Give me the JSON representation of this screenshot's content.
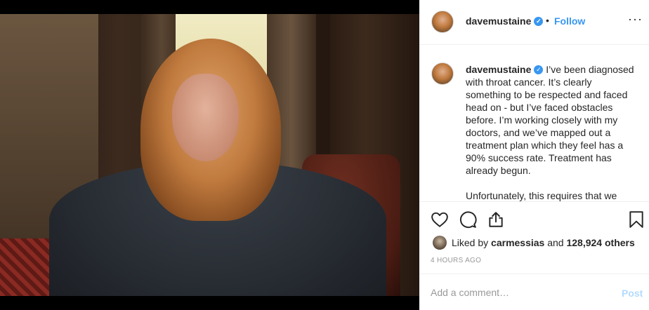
{
  "post": {
    "username": "davemustaine",
    "follow_label": "Follow",
    "dot": "•",
    "more": "···",
    "caption": "I’ve been diagnosed with throat cancer. It’s clearly something to be respected and faced head on - but I’ve faced obstacles before. I’m working closely with my doctors, and we’ve mapped out a treatment plan which they feel has a 90% success rate. Treatment has already begun.\n\nUnfortunately, this requires that we",
    "verified_glyph": "✓"
  },
  "likes": {
    "prefix": "Liked by ",
    "liker": "carmessias",
    "conjunction": " and ",
    "count_text": "128,924 others"
  },
  "timestamp": "4 HOURS AGO",
  "comment": {
    "placeholder": "Add a comment…",
    "post_label": "Post"
  },
  "icons": {
    "like": "heart-icon",
    "comment": "comment-icon",
    "share": "share-icon",
    "bookmark": "bookmark-icon"
  },
  "colors": {
    "accent": "#3897f0",
    "post_disabled": "#b3dbff",
    "muted": "#999999",
    "text": "#262626"
  }
}
